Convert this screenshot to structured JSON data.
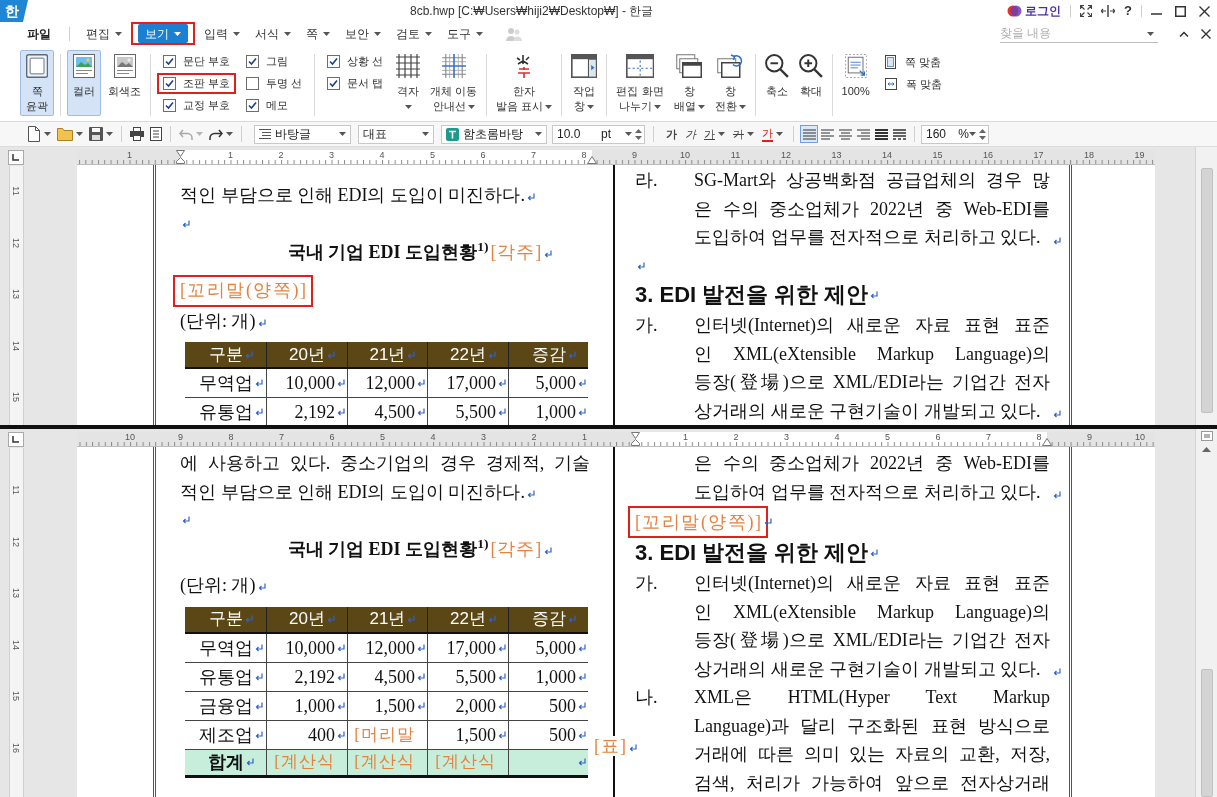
{
  "title_bar": {
    "logo": "한",
    "title": "8cb.hwp [C:₩Users₩hiji2₩Desktop₩] - 한글",
    "login": "로그인",
    "help": "?"
  },
  "menu": {
    "items": [
      {
        "label": "파일",
        "kind": "backstage",
        "dropdown": false,
        "selected": false,
        "marked": false
      },
      {
        "label": "편집",
        "kind": "tab",
        "dropdown": true,
        "selected": false,
        "marked": false
      },
      {
        "label": "보기",
        "kind": "tab",
        "dropdown": true,
        "selected": true,
        "marked": true
      },
      {
        "label": "입력",
        "kind": "tab",
        "dropdown": true,
        "selected": false,
        "marked": false
      },
      {
        "label": "서식",
        "kind": "tab",
        "dropdown": true,
        "selected": false,
        "marked": false
      },
      {
        "label": "쪽",
        "kind": "tab",
        "dropdown": true,
        "selected": false,
        "marked": false
      },
      {
        "label": "보안",
        "kind": "tab",
        "dropdown": true,
        "selected": false,
        "marked": false
      },
      {
        "label": "검토",
        "kind": "tab",
        "dropdown": true,
        "selected": false,
        "marked": false
      },
      {
        "label": "도구",
        "kind": "tab",
        "dropdown": true,
        "selected": false,
        "marked": false
      }
    ],
    "search": {
      "placeholder": "찾을 내용"
    }
  },
  "ribbon": {
    "sections": [
      {
        "items": [
          {
            "kind": "toggle",
            "lines": [
              "쪽",
              "윤곽"
            ],
            "selected": true
          }
        ]
      },
      {
        "items": [
          {
            "kind": "toggle",
            "lines": [
              "컬러"
            ],
            "selected": true
          },
          {
            "kind": "toggle",
            "lines": [
              "회색조"
            ],
            "selected": false
          }
        ]
      },
      {
        "items": [
          {
            "kind": "checks",
            "boxes": [
              {
                "label": "문단 부호",
                "checked": true,
                "marked": false
              },
              {
                "label": "조판 부호",
                "checked": true,
                "marked": true
              },
              {
                "label": "교정 부호",
                "checked": true,
                "marked": false
              }
            ]
          },
          {
            "kind": "checks",
            "boxes": [
              {
                "label": "그림",
                "checked": true,
                "marked": false
              },
              {
                "label": "투명 선",
                "checked": false,
                "marked": false
              },
              {
                "label": "메모",
                "checked": true,
                "marked": false
              }
            ]
          }
        ]
      },
      {
        "items": [
          {
            "kind": "checks",
            "boxes": [
              {
                "label": "상황 선",
                "checked": true,
                "marked": false
              },
              {
                "label": "문서 탭",
                "checked": true,
                "marked": false
              }
            ]
          },
          {
            "kind": "button",
            "lines": [
              "격자"
            ],
            "dropdown": true
          },
          {
            "kind": "button",
            "lines": [
              "개체 이동",
              "안내선"
            ],
            "dropdown": true
          }
        ]
      },
      {
        "items": [
          {
            "kind": "button",
            "lines": [
              "한자",
              "발음 표시"
            ],
            "dropdown": true
          }
        ]
      },
      {
        "items": [
          {
            "kind": "button",
            "lines": [
              "작업",
              "창"
            ],
            "dropdown": true
          }
        ]
      },
      {
        "items": [
          {
            "kind": "button",
            "lines": [
              "편집 화면",
              "나누기"
            ],
            "dropdown": true
          },
          {
            "kind": "button",
            "lines": [
              "창",
              "배열"
            ],
            "dropdown": true
          },
          {
            "kind": "button",
            "lines": [
              "창",
              "전환"
            ],
            "dropdown": true
          }
        ]
      },
      {
        "items": [
          {
            "kind": "button",
            "lines": [
              "축소"
            ],
            "dropdown": false
          },
          {
            "kind": "button",
            "lines": [
              "확대"
            ],
            "dropdown": false
          }
        ]
      },
      {
        "items": [
          {
            "kind": "button",
            "lines": [
              "100%"
            ],
            "dropdown": false
          },
          {
            "kind": "small_buttons",
            "buttons": [
              {
                "label": "쪽 맞춤"
              },
              {
                "label": "폭 맞춤"
              }
            ]
          }
        ]
      }
    ]
  },
  "toolbar": {
    "buttons": [
      {
        "dropdown": true,
        "disabled": false
      },
      {
        "dropdown": true,
        "disabled": false
      },
      {
        "dropdown": true,
        "disabled": false
      },
      {
        "dropdown": false,
        "disabled": false
      },
      {
        "dropdown": false,
        "disabled": false
      },
      {
        "dropdown": true,
        "disabled": true
      },
      {
        "dropdown": true,
        "disabled": false
      }
    ],
    "style": "바탕글",
    "language": "대표",
    "font": "함초롬바탕",
    "size": "10.0",
    "unit": "pt",
    "format_buttons": [
      {
        "kind": "bold",
        "label": "가",
        "dropdown": false
      },
      {
        "kind": "italic",
        "label": "가",
        "dropdown": false
      },
      {
        "kind": "underline",
        "label": "가",
        "dropdown": true
      },
      {
        "kind": "strike",
        "label": "가",
        "dropdown": true
      },
      {
        "kind": "color",
        "label": "가",
        "dropdown": true
      }
    ],
    "align_buttons": [
      {
        "selected": true
      },
      {
        "selected": false
      },
      {
        "selected": false
      },
      {
        "selected": false
      },
      {
        "selected": false
      },
      {
        "selected": false
      }
    ],
    "zoom": "160",
    "zoom_unit": "%"
  },
  "panes": [
    {
      "ruler": {
        "kind": "left",
        "before_origin": [
          "1"
        ],
        "after_origin": [
          "1",
          "2",
          "3",
          "4",
          "5",
          "6",
          "7",
          "8",
          "9",
          "10",
          "11",
          "12",
          "13",
          "14",
          "15",
          "16",
          "17",
          "18",
          "19"
        ]
      },
      "vertical_ruler": [
        "11",
        "12",
        "13",
        "14",
        "15"
      ],
      "left_column": [
        {
          "kind": "text",
          "lines": [
            "적인 부담으로 인해 EDI의 도입이 미진하다."
          ],
          "mark": true
        },
        {
          "kind": "empty",
          "mark": true
        },
        {
          "kind": "caption",
          "text": "국내 기업 EDI 도입현황$^{1)}$",
          "code": "[각주]",
          "mark": true
        },
        {
          "kind": "code",
          "text": "[꼬리말(양쪽)]",
          "marked": true,
          "mark": false
        },
        {
          "kind": "text",
          "lines": [
            "(단위: 개)"
          ],
          "mark": true
        },
        {
          "kind": "table",
          "columns": [
            "구분",
            "20년",
            "21년",
            "22년",
            "증감"
          ],
          "cell_marks": true,
          "rows": [
            {
              "kind": "data",
              "cells": [
                {
                  "kind": "label",
                  "text": "무역업"
                },
                {
                  "kind": "value",
                  "text": "10,000"
                },
                {
                  "kind": "value",
                  "text": "12,000"
                },
                {
                  "kind": "value",
                  "text": "17,000"
                },
                {
                  "kind": "value",
                  "text": "5,000"
                }
              ]
            },
            {
              "kind": "data",
              "cells": [
                {
                  "kind": "label",
                  "text": "유통업"
                },
                {
                  "kind": "value",
                  "text": "2,192"
                },
                {
                  "kind": "value",
                  "text": "4,500"
                },
                {
                  "kind": "value",
                  "text": "5,500"
                },
                {
                  "kind": "value",
                  "text": "1,000"
                }
              ]
            }
          ]
        }
      ],
      "right_column": [
        {
          "kind": "list_item",
          "marker": "라.",
          "lines": [
            "SG-Mart와 상공백화점 공급업체의 경우 많",
            "은 수의 중소업체가 2022년 중 Web-EDI를",
            "도입하여 업무를 전자적으로 처리하고 있다."
          ],
          "mark": true
        },
        {
          "kind": "empty",
          "mark": true
        },
        {
          "kind": "heading",
          "text": "3. EDI 발전을 위한 제안",
          "mark": true
        },
        {
          "kind": "list_item",
          "marker": "가.",
          "lines": [
            "인터넷(Internet)의 새로운 자료 표현 표준",
            "인 XML(eXtensible Markup Language)의",
            "등장(登場)으로 XML/EDI라는 기업간 전자",
            "상거래의 새로운 구현기술이 개발되고 있다."
          ],
          "mark": true
        }
      ]
    },
    {
      "ruler": {
        "kind": "right",
        "before_origin": [
          "10",
          "9",
          "8",
          "7",
          "6",
          "5",
          "4",
          "3",
          "2",
          "1"
        ],
        "after_origin": [
          "1",
          "2",
          "3",
          "4",
          "5",
          "6",
          "7",
          "8",
          "9",
          "10"
        ]
      },
      "vertical_ruler": [
        "11",
        "12",
        "13",
        "14",
        "15",
        "16"
      ],
      "left_column": [
        {
          "kind": "text",
          "lines": [
            "에 사용하고 있다. 중소기업의 경우 경제적, 기술"
          ],
          "mark": false
        },
        {
          "kind": "text",
          "lines": [
            "적인 부담으로 인해 EDI의 도입이 미진하다."
          ],
          "mark": true
        },
        {
          "kind": "empty",
          "mark": true
        },
        {
          "kind": "caption",
          "text": "국내 기업 EDI 도입현황$^{1)}$",
          "code": "[각주]",
          "mark": true
        },
        {
          "kind": "text",
          "lines": [
            "(단위: 개)"
          ],
          "mark": true
        },
        {
          "kind": "table",
          "columns": [
            "구분",
            "20년",
            "21년",
            "22년",
            "증감"
          ],
          "cell_marks": true,
          "rows": [
            {
              "kind": "data",
              "cells": [
                {
                  "kind": "label",
                  "text": "무역업"
                },
                {
                  "kind": "value",
                  "text": "10,000"
                },
                {
                  "kind": "value",
                  "text": "12,000"
                },
                {
                  "kind": "value",
                  "text": "17,000"
                },
                {
                  "kind": "value",
                  "text": "5,000"
                }
              ]
            },
            {
              "kind": "data",
              "cells": [
                {
                  "kind": "label",
                  "text": "유통업"
                },
                {
                  "kind": "value",
                  "text": "2,192"
                },
                {
                  "kind": "value",
                  "text": "4,500"
                },
                {
                  "kind": "value",
                  "text": "5,500"
                },
                {
                  "kind": "value",
                  "text": "1,000"
                }
              ]
            },
            {
              "kind": "data",
              "cells": [
                {
                  "kind": "label",
                  "text": "금융업"
                },
                {
                  "kind": "value",
                  "text": "1,000"
                },
                {
                  "kind": "value",
                  "text": "1,500"
                },
                {
                  "kind": "value",
                  "text": "2,000"
                },
                {
                  "kind": "value",
                  "text": "500"
                }
              ]
            },
            {
              "kind": "data",
              "cells": [
                {
                  "kind": "label",
                  "text": "제조업"
                },
                {
                  "kind": "value",
                  "text": "400"
                },
                {
                  "kind": "code",
                  "text": "[머리말"
                },
                {
                  "kind": "value",
                  "text": "1,500"
                },
                {
                  "kind": "value",
                  "text": "500"
                }
              ]
            },
            {
              "kind": "total",
              "cells": [
                {
                  "kind": "label",
                  "text": "합계"
                },
                {
                  "kind": "code",
                  "text": "[계산식"
                },
                {
                  "kind": "code",
                  "text": "[계산식"
                },
                {
                  "kind": "code",
                  "text": "[계산식"
                },
                {
                  "kind": "empty"
                }
              ]
            }
          ],
          "after_code": "[표]",
          "after_mark": true
        }
      ],
      "right_column": [
        {
          "kind": "list_item",
          "lines": [
            "은 수의 중소업체가 2022년 중 Web-EDI를",
            "도입하여 업무를 전자적으로 처리하고 있다."
          ],
          "mark": true
        },
        {
          "kind": "code",
          "text": "[꼬리말(양쪽)]",
          "marked": true,
          "mark": true
        },
        {
          "kind": "heading",
          "text": "3. EDI 발전을 위한 제안",
          "mark": true
        },
        {
          "kind": "list_item",
          "marker": "가.",
          "lines": [
            "인터넷(Internet)의 새로운 자료 표현 표준",
            "인 XML(eXtensible Markup Language)의",
            "등장(登場)으로 XML/EDI라는 기업간 전자",
            "상거래의 새로운 구현기술이 개발되고 있다."
          ],
          "mark": true
        },
        {
          "kind": "list_item",
          "marker": "나.",
          "lines": [
            "XML은 HTML(Hyper Text Markup",
            "Language)과 달리 구조화된 표현 방식으로",
            "거래에 따른 의미 있는 자료의 교환, 저장,",
            "검색, 처리가 가능하여 앞으로 전자상거래"
          ],
          "mark": false
        }
      ]
    }
  ]
}
